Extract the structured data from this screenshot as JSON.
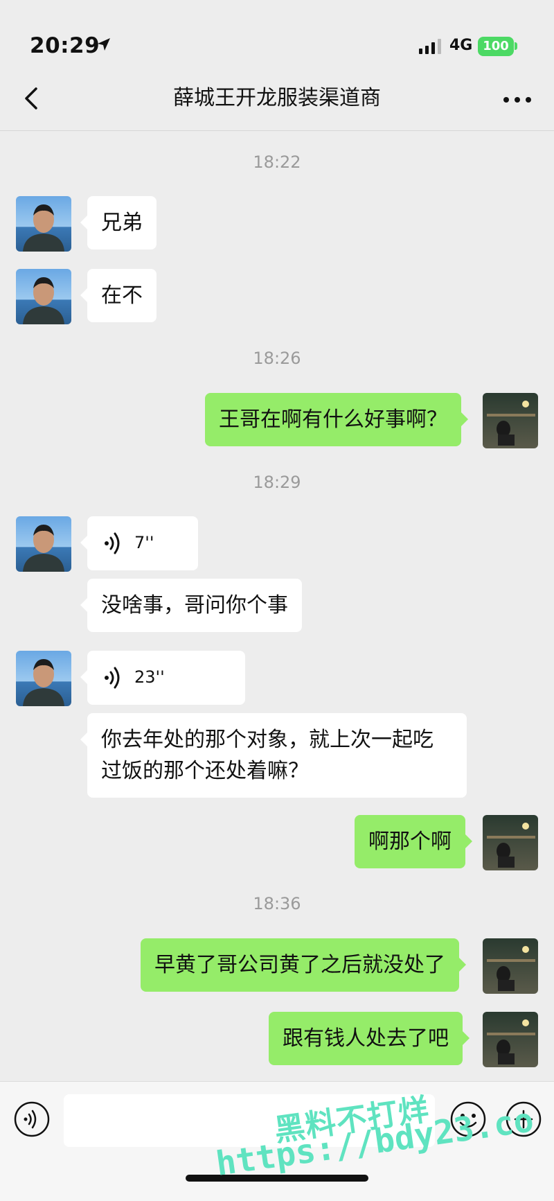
{
  "status_bar": {
    "time": "20:29",
    "network": "4G",
    "battery": "100"
  },
  "header": {
    "title": "薛城王开龙服装渠道商"
  },
  "timestamps": [
    "18:22",
    "18:26",
    "18:29",
    "18:36"
  ],
  "messages": [
    {
      "side": "in",
      "type": "text",
      "text": "兄弟"
    },
    {
      "side": "in",
      "type": "text",
      "text": "在不"
    },
    {
      "side": "out",
      "type": "text",
      "text": "王哥在啊有什么好事啊？"
    },
    {
      "side": "in",
      "type": "voice",
      "duration": "7''"
    },
    {
      "side": "in",
      "type": "text",
      "text": "没啥事，哥问你个事"
    },
    {
      "side": "in",
      "type": "voice",
      "duration": "23''"
    },
    {
      "side": "in",
      "type": "text",
      "text": "你去年处的那个对象，就上次一起吃过饭的那个还处着嘛？"
    },
    {
      "side": "out",
      "type": "text",
      "text": "啊那个啊"
    },
    {
      "side": "out",
      "type": "text",
      "text": "早黄了哥公司黄了之后就没处了"
    },
    {
      "side": "out",
      "type": "text",
      "text": "跟有钱人处去了吧"
    }
  ],
  "watermark": {
    "line1": "黑料不打烊",
    "line2": "https://bdy23.co"
  },
  "colors": {
    "background": "#ededed",
    "outgoing_bubble": "#95ec69",
    "incoming_bubble": "#ffffff",
    "battery": "#4cd964",
    "watermark": "#5fe3c0"
  }
}
